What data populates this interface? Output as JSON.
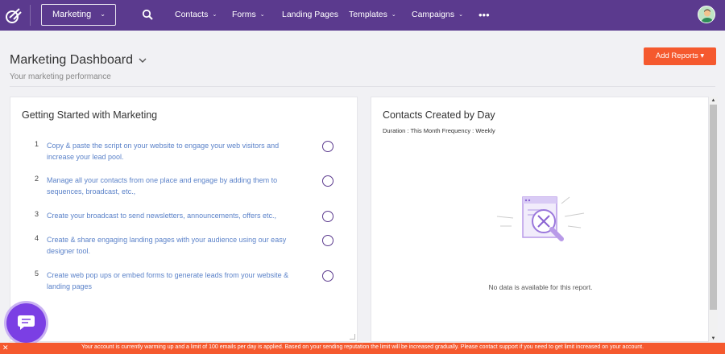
{
  "nav": {
    "workspace": "Marketing",
    "items": [
      {
        "label": "Contacts",
        "has_dropdown": true
      },
      {
        "label": "Forms",
        "has_dropdown": true
      },
      {
        "label": "Landing Pages",
        "has_dropdown": false
      },
      {
        "label": "Templates",
        "has_dropdown": true
      },
      {
        "label": "Campaigns",
        "has_dropdown": true
      }
    ],
    "more_icon": "ellipsis-icon",
    "caret": "⌄",
    "more_glyph": "•••"
  },
  "header": {
    "title": "Marketing Dashboard",
    "subtitle": "Your marketing performance",
    "add_reports_label": "Add Reports ▾"
  },
  "getting_started": {
    "title": "Getting Started with Marketing",
    "steps": [
      {
        "num": "1",
        "text": "Copy & paste the script on your website to engage your web visitors and increase your lead pool."
      },
      {
        "num": "2",
        "text": "Manage all your contacts from one place and engage by adding them to sequences, broadcast, etc.,"
      },
      {
        "num": "3",
        "text": "Create your broadcast to send newsletters, announcements, offers etc.,"
      },
      {
        "num": "4",
        "text": "Create & share engaging landing pages with your audience using our easy designer tool."
      },
      {
        "num": "5",
        "text": "Create web pop ups or embed forms to generate leads from your website & landing pages"
      }
    ]
  },
  "contacts_report": {
    "title": "Contacts Created by Day",
    "duration": "Duration : This Month Frequency : Weekly",
    "empty_message": "No data is available for this report."
  },
  "scrollbar": {
    "up": "▲",
    "down": "▼"
  },
  "banner": {
    "close": "✕",
    "text": "Your account is currently warming up and a limit of 100 emails per day is applied. Based on your sending reputation the limit will be increased gradually. Please contact support if you need to get limit increased on your account."
  },
  "colors": {
    "nav_bg": "#5b3a8e",
    "accent_orange": "#f5592e",
    "link_blue": "#5b82c9",
    "chat_purple": "#7b3fe4"
  }
}
